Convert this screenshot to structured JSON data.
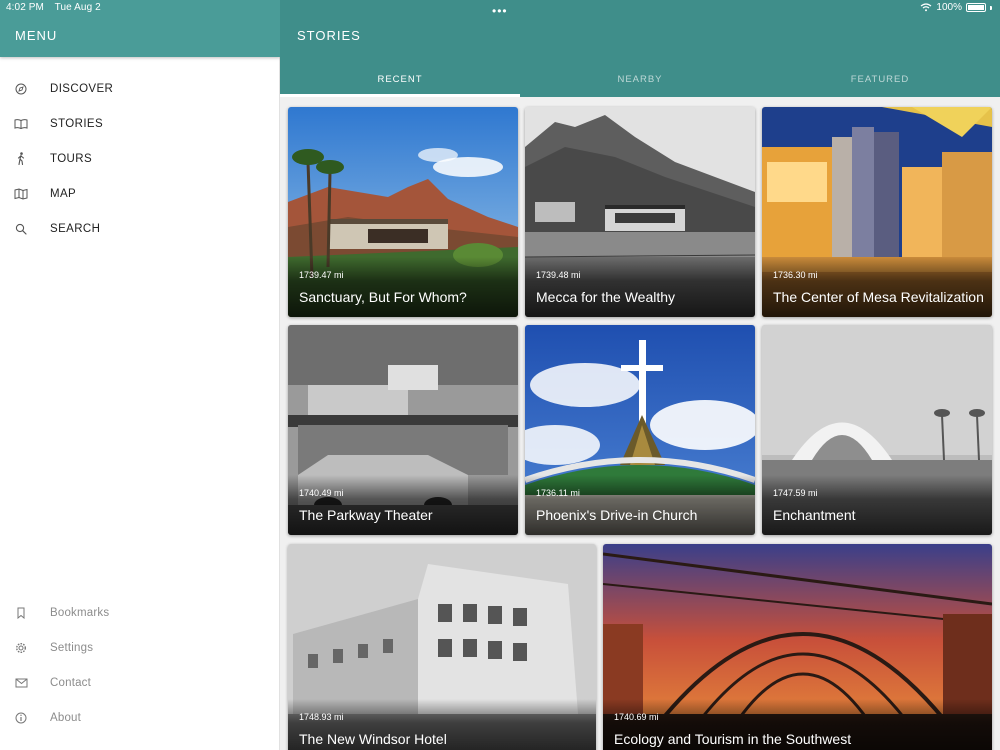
{
  "status_bar": {
    "time": "4:02 PM",
    "date": "Tue Aug 2",
    "battery": "100%"
  },
  "sidebar": {
    "title": "MENU",
    "items": [
      {
        "label": "DISCOVER",
        "icon": "compass-icon"
      },
      {
        "label": "STORIES",
        "icon": "book-icon"
      },
      {
        "label": "TOURS",
        "icon": "walking-icon"
      },
      {
        "label": "MAP",
        "icon": "map-icon"
      },
      {
        "label": "SEARCH",
        "icon": "search-icon"
      }
    ],
    "bottom_items": [
      {
        "label": "Bookmarks",
        "icon": "bookmark-icon"
      },
      {
        "label": "Settings",
        "icon": "gear-icon"
      },
      {
        "label": "Contact",
        "icon": "envelope-icon"
      },
      {
        "label": "About",
        "icon": "info-icon"
      }
    ]
  },
  "main": {
    "title": "STORIES",
    "tabs": [
      {
        "label": "RECENT",
        "active": true
      },
      {
        "label": "NEARBY",
        "active": false
      },
      {
        "label": "FEATURED",
        "active": false
      }
    ],
    "cards": [
      {
        "distance": "1739.47 mi",
        "title": "Sanctuary, But For Whom?"
      },
      {
        "distance": "1739.48 mi",
        "title": "Mecca for the Wealthy"
      },
      {
        "distance": "1736.30 mi",
        "title": "The Center of Mesa Revitalization"
      },
      {
        "distance": "1740.49 mi",
        "title": "The Parkway Theater"
      },
      {
        "distance": "1736.11 mi",
        "title": "Phoenix's Drive-in Church"
      },
      {
        "distance": "1747.59 mi",
        "title": "Enchantment"
      },
      {
        "distance": "1748.93 mi",
        "title": "The New Windsor Hotel"
      },
      {
        "distance": "1740.69 mi",
        "title": "Ecology and Tourism in the Southwest"
      }
    ]
  },
  "colors": {
    "sidebar_header": "#4a9c98",
    "main_header": "#3f8e8a",
    "background": "#f0f0f0"
  }
}
